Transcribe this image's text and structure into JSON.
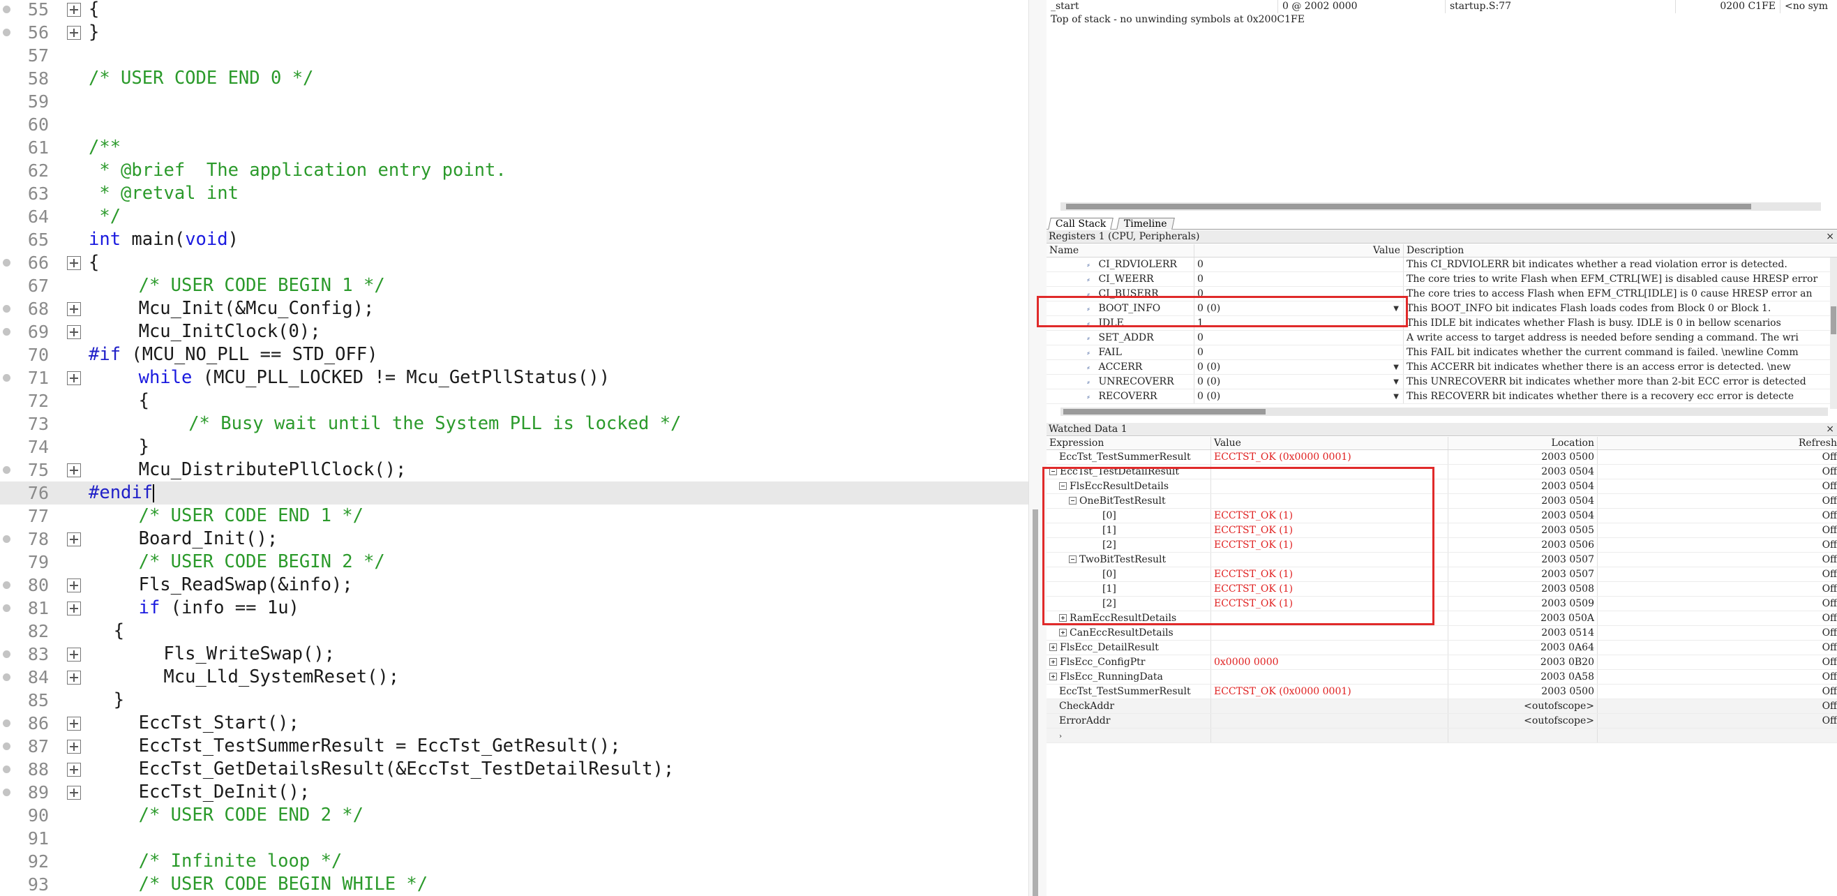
{
  "editor": {
    "lines": [
      {
        "n": "55",
        "dot": true,
        "fold": true,
        "indent": 0,
        "parts": [
          {
            "t": "{",
            "c": "plain"
          }
        ]
      },
      {
        "n": "56",
        "dot": true,
        "fold": true,
        "indent": 0,
        "parts": [
          {
            "t": "}",
            "c": "plain"
          }
        ]
      },
      {
        "n": "57",
        "dot": false,
        "fold": false,
        "indent": 0,
        "parts": []
      },
      {
        "n": "58",
        "dot": false,
        "fold": false,
        "indent": 0,
        "parts": [
          {
            "t": "/* USER CODE END 0 */",
            "c": "comment"
          }
        ]
      },
      {
        "n": "59",
        "dot": false,
        "fold": false,
        "indent": 0,
        "parts": []
      },
      {
        "n": "60",
        "dot": false,
        "fold": false,
        "indent": 0,
        "parts": []
      },
      {
        "n": "61",
        "dot": false,
        "fold": false,
        "indent": 0,
        "parts": [
          {
            "t": "/**",
            "c": "comment"
          }
        ]
      },
      {
        "n": "62",
        "dot": false,
        "fold": false,
        "indent": 0,
        "parts": [
          {
            "t": " * @brief  The application entry point.",
            "c": "comment"
          }
        ]
      },
      {
        "n": "63",
        "dot": false,
        "fold": false,
        "indent": 0,
        "parts": [
          {
            "t": " * @retval int",
            "c": "comment"
          }
        ]
      },
      {
        "n": "64",
        "dot": false,
        "fold": false,
        "indent": 0,
        "parts": [
          {
            "t": " */",
            "c": "comment"
          }
        ]
      },
      {
        "n": "65",
        "dot": false,
        "fold": false,
        "indent": 0,
        "parts": [
          {
            "t": "int",
            "c": "keyword"
          },
          {
            "t": " main(",
            "c": "plain"
          },
          {
            "t": "void",
            "c": "keyword"
          },
          {
            "t": ")",
            "c": "plain"
          }
        ]
      },
      {
        "n": "66",
        "dot": true,
        "fold": true,
        "indent": 0,
        "parts": [
          {
            "t": "{",
            "c": "plain"
          }
        ]
      },
      {
        "n": "67",
        "dot": false,
        "fold": false,
        "indent": 4,
        "parts": [
          {
            "t": "/* USER CODE BEGIN 1 */",
            "c": "comment"
          }
        ]
      },
      {
        "n": "68",
        "dot": true,
        "fold": true,
        "indent": 4,
        "parts": [
          {
            "t": "Mcu_Init(&Mcu_Config);",
            "c": "plain"
          }
        ]
      },
      {
        "n": "69",
        "dot": true,
        "fold": true,
        "indent": 4,
        "parts": [
          {
            "t": "Mcu_InitClock(0);",
            "c": "plain"
          }
        ]
      },
      {
        "n": "70",
        "dot": false,
        "fold": false,
        "indent": 0,
        "parts": [
          {
            "t": "#if",
            "c": "pre"
          },
          {
            "t": " (MCU_NO_PLL == STD_OFF)",
            "c": "plain"
          }
        ]
      },
      {
        "n": "71",
        "dot": true,
        "fold": true,
        "indent": 4,
        "parts": [
          {
            "t": "while",
            "c": "keyword"
          },
          {
            "t": " (MCU_PLL_LOCKED != Mcu_GetPllStatus())",
            "c": "plain"
          }
        ]
      },
      {
        "n": "72",
        "dot": false,
        "fold": false,
        "indent": 4,
        "parts": [
          {
            "t": "{",
            "c": "plain"
          }
        ]
      },
      {
        "n": "73",
        "dot": false,
        "fold": false,
        "indent": 8,
        "parts": [
          {
            "t": "/* Busy wait until the System PLL is locked */",
            "c": "comment"
          }
        ]
      },
      {
        "n": "74",
        "dot": false,
        "fold": false,
        "indent": 4,
        "parts": [
          {
            "t": "}",
            "c": "plain"
          }
        ]
      },
      {
        "n": "75",
        "dot": true,
        "fold": true,
        "indent": 4,
        "parts": [
          {
            "t": "Mcu_DistributePllClock();",
            "c": "plain"
          }
        ]
      },
      {
        "n": "76",
        "dot": false,
        "fold": false,
        "indent": 0,
        "current": true,
        "parts": [
          {
            "t": "#endif",
            "c": "pre"
          }
        ]
      },
      {
        "n": "77",
        "dot": false,
        "fold": false,
        "indent": 4,
        "parts": [
          {
            "t": "/* USER CODE END 1 */",
            "c": "comment"
          }
        ]
      },
      {
        "n": "78",
        "dot": true,
        "fold": true,
        "indent": 4,
        "parts": [
          {
            "t": "Board_Init();",
            "c": "plain"
          }
        ]
      },
      {
        "n": "79",
        "dot": false,
        "fold": false,
        "indent": 4,
        "parts": [
          {
            "t": "/* USER CODE BEGIN 2 */",
            "c": "comment"
          }
        ]
      },
      {
        "n": "80",
        "dot": true,
        "fold": true,
        "indent": 4,
        "parts": [
          {
            "t": "Fls_ReadSwap(&info);",
            "c": "plain"
          }
        ]
      },
      {
        "n": "81",
        "dot": true,
        "fold": true,
        "indent": 4,
        "parts": [
          {
            "t": "if",
            "c": "keyword"
          },
          {
            "t": " (info == 1u)",
            "c": "plain"
          }
        ]
      },
      {
        "n": "82",
        "dot": false,
        "fold": false,
        "indent": 2,
        "parts": [
          {
            "t": "{",
            "c": "plain"
          }
        ]
      },
      {
        "n": "83",
        "dot": true,
        "fold": true,
        "indent": 6,
        "parts": [
          {
            "t": "Fls_WriteSwap();",
            "c": "plain"
          }
        ]
      },
      {
        "n": "84",
        "dot": true,
        "fold": true,
        "indent": 6,
        "parts": [
          {
            "t": "Mcu_Lld_SystemReset();",
            "c": "plain"
          }
        ]
      },
      {
        "n": "85",
        "dot": false,
        "fold": false,
        "indent": 2,
        "parts": [
          {
            "t": "}",
            "c": "plain"
          }
        ]
      },
      {
        "n": "86",
        "dot": true,
        "fold": true,
        "indent": 4,
        "parts": [
          {
            "t": "EccTst_Start();",
            "c": "plain"
          }
        ]
      },
      {
        "n": "87",
        "dot": true,
        "fold": true,
        "indent": 4,
        "parts": [
          {
            "t": "EccTst_TestSummerResult = EccTst_GetResult();",
            "c": "plain"
          }
        ]
      },
      {
        "n": "88",
        "dot": true,
        "fold": true,
        "indent": 4,
        "parts": [
          {
            "t": "EccTst_GetDetailsResult(&EccTst_TestDetailResult);",
            "c": "plain"
          }
        ]
      },
      {
        "n": "89",
        "dot": true,
        "fold": true,
        "indent": 4,
        "parts": [
          {
            "t": "EccTst_DeInit();",
            "c": "plain"
          }
        ]
      },
      {
        "n": "90",
        "dot": false,
        "fold": false,
        "indent": 4,
        "parts": [
          {
            "t": "/* USER CODE END 2 */",
            "c": "comment"
          }
        ]
      },
      {
        "n": "91",
        "dot": false,
        "fold": false,
        "indent": 0,
        "parts": []
      },
      {
        "n": "92",
        "dot": false,
        "fold": false,
        "indent": 4,
        "parts": [
          {
            "t": "/* Infinite loop */",
            "c": "comment"
          }
        ]
      },
      {
        "n": "93",
        "dot": false,
        "fold": false,
        "indent": 4,
        "parts": [
          {
            "t": "/* USER CODE BEGIN WHILE */",
            "c": "comment"
          }
        ]
      }
    ]
  },
  "callstack": {
    "row": {
      "function": "_start",
      "frame": "0 @ 2002 0000",
      "source": "startup.S:77",
      "pc": "0200 C1FE",
      "extra": "<no sym"
    },
    "message": "Top of stack - no unwinding symbols at 0x200C1FE"
  },
  "tabs": [
    {
      "label": "Call Stack",
      "active": true
    },
    {
      "label": "Timeline",
      "active": false
    }
  ],
  "registers": {
    "title": "Registers 1 (CPU, Peripherals)",
    "close": "×",
    "headers": {
      "name": "Name",
      "value": "Value",
      "description": "Description"
    },
    "rows": [
      {
        "name": "CI_RDVIOLERR",
        "value": "0",
        "dropdown": false,
        "description": "This CI_RDVIOLERR bit indicates whether a read violation error is detected."
      },
      {
        "name": "CI_WEERR",
        "value": "0",
        "dropdown": false,
        "description": "The core tries to write Flash when EFM_CTRL[WE] is disabled cause HRESP error"
      },
      {
        "name": "CI_BUSERR",
        "value": "0",
        "dropdown": false,
        "description": "The core tries to access Flash when EFM_CTRL[IDLE] is 0 cause HRESP error an"
      },
      {
        "name": "BOOT_INFO",
        "value": "0 (0)",
        "dropdown": true,
        "description": "This BOOT_INFO bit indicates Flash loads codes from Block 0 or Block 1."
      },
      {
        "name": "IDLE",
        "value": "1",
        "dropdown": false,
        "description": "This IDLE bit indicates whether Flash is busy. IDLE is 0 in bellow scenarios"
      },
      {
        "name": "SET_ADDR",
        "value": "0",
        "dropdown": false,
        "description": "A write access to target address is needed before sending a command. The wri"
      },
      {
        "name": "FAIL",
        "value": "0",
        "dropdown": false,
        "description": "This FAIL bit indicates whether the current command is failed. \\newline Comm"
      },
      {
        "name": "ACCERR",
        "value": "0 (0)",
        "dropdown": true,
        "description": "This ACCERR bit indicates whether there is an access error is detected. \\new"
      },
      {
        "name": "UNRECOVERR",
        "value": "0 (0)",
        "dropdown": true,
        "description": "This UNRECOVERR bit indicates whether more than 2-bit ECC error is detected"
      },
      {
        "name": "RECOVERR",
        "value": "0 (0)",
        "dropdown": true,
        "description": "This RECOVERR bit indicates whether there is a recovery ecc error is detecte"
      }
    ]
  },
  "watch": {
    "title": "Watched Data 1",
    "close": "×",
    "headers": {
      "expression": "Expression",
      "value": "Value",
      "location": "Location",
      "refresh": "Refresh"
    },
    "rows": [
      {
        "expr": "EccTst_TestSummerResult",
        "level": 0,
        "box": "none",
        "value": "ECCTST_OK (0x0000 0001)",
        "loc": "2003 0500",
        "ref": "Off"
      },
      {
        "expr": "EccTst_TestDetailResult",
        "level": 0,
        "box": "minus",
        "value": "",
        "loc": "2003 0504",
        "ref": "Off"
      },
      {
        "expr": "FlsEccResultDetails",
        "level": 1,
        "box": "minus",
        "value": "",
        "loc": "2003 0504",
        "ref": "Off"
      },
      {
        "expr": "OneBitTestResult",
        "level": 2,
        "box": "minus",
        "value": "",
        "loc": "2003 0504",
        "ref": "Off"
      },
      {
        "expr": "[0]",
        "level": 3,
        "box": "none",
        "value": "ECCTST_OK (1)",
        "loc": "2003 0504",
        "ref": "Off"
      },
      {
        "expr": "[1]",
        "level": 3,
        "box": "none",
        "value": "ECCTST_OK (1)",
        "loc": "2003 0505",
        "ref": "Off"
      },
      {
        "expr": "[2]",
        "level": 3,
        "box": "none",
        "value": "ECCTST_OK (1)",
        "loc": "2003 0506",
        "ref": "Off"
      },
      {
        "expr": "TwoBitTestResult",
        "level": 2,
        "box": "minus",
        "value": "",
        "loc": "2003 0507",
        "ref": "Off"
      },
      {
        "expr": "[0]",
        "level": 3,
        "box": "none",
        "value": "ECCTST_OK (1)",
        "loc": "2003 0507",
        "ref": "Off"
      },
      {
        "expr": "[1]",
        "level": 3,
        "box": "none",
        "value": "ECCTST_OK (1)",
        "loc": "2003 0508",
        "ref": "Off"
      },
      {
        "expr": "[2]",
        "level": 3,
        "box": "none",
        "value": "ECCTST_OK (1)",
        "loc": "2003 0509",
        "ref": "Off"
      },
      {
        "expr": "RamEccResultDetails",
        "level": 1,
        "box": "plus",
        "value": "",
        "loc": "2003 050A",
        "ref": "Off"
      },
      {
        "expr": "CanEccResultDetails",
        "level": 1,
        "box": "plus",
        "value": "",
        "loc": "2003 0514",
        "ref": "Off"
      },
      {
        "expr": "FlsEcc_DetailResult",
        "level": 0,
        "box": "plus",
        "value": "",
        "loc": "2003 0A64",
        "ref": "Off"
      },
      {
        "expr": "FlsEcc_ConfigPtr",
        "level": 0,
        "box": "plus",
        "value": "0x0000 0000",
        "loc": "2003 0B20",
        "ref": "Off"
      },
      {
        "expr": "FlsEcc_RunningData",
        "level": 0,
        "box": "plus",
        "value": "",
        "loc": "2003 0A58",
        "ref": "Off"
      },
      {
        "expr": "EccTst_TestSummerResult",
        "level": 0,
        "box": "none",
        "value": "ECCTST_OK (0x0000 0001)",
        "loc": "2003 0500",
        "ref": "Off"
      },
      {
        "expr": "CheckAddr",
        "level": 0,
        "box": "none",
        "value": "",
        "loc": "<outofscope>",
        "ref": "Off"
      },
      {
        "expr": "ErrorAddr",
        "level": 0,
        "box": "none",
        "value": "",
        "loc": "<outofscope>",
        "ref": "Off"
      },
      {
        "expr": "",
        "level": 0,
        "box": "none",
        "value": "",
        "loc": "",
        "ref": ""
      }
    ]
  },
  "colors": {
    "highlight": "#e02a2a",
    "value_red": "#e02020",
    "comment": "#2b9a2b",
    "keyword": "#1a1adf"
  }
}
